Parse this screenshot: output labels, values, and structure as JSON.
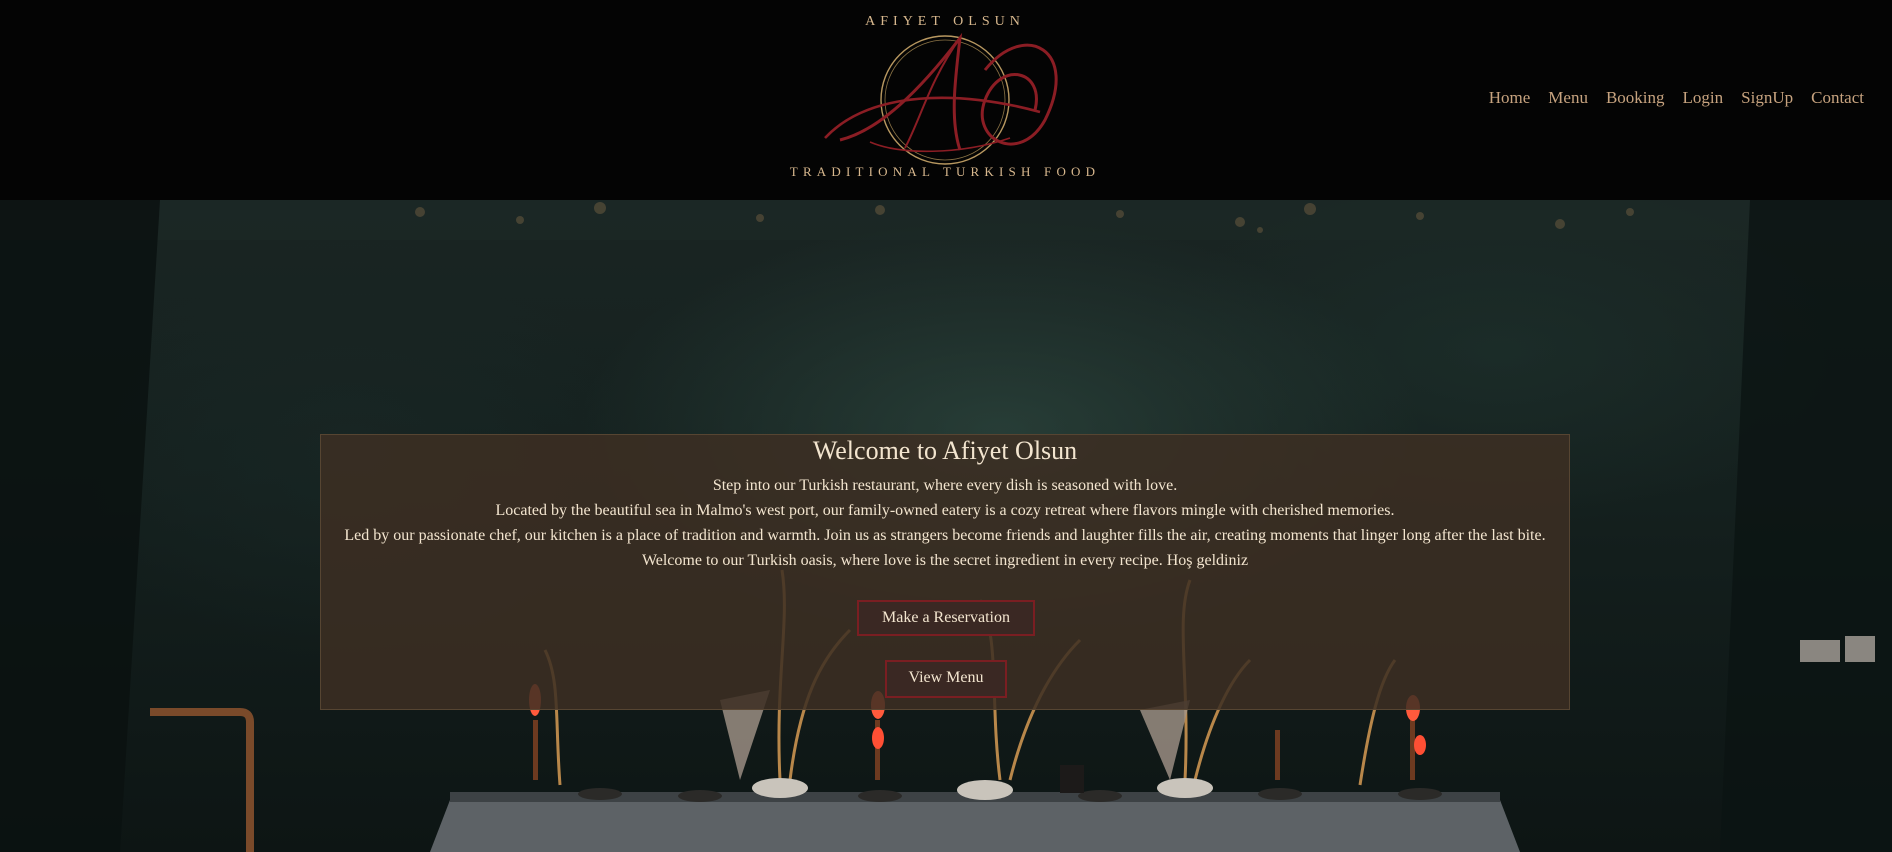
{
  "brand": {
    "name_top": "AFIYET OLSUN",
    "tagline": "TRADITIONAL TURKISH FOOD",
    "monogram": "AO",
    "colors": {
      "gold": "#d8b88e",
      "crimson": "#8b1d24"
    }
  },
  "nav": {
    "items": [
      {
        "label": "Home"
      },
      {
        "label": "Menu"
      },
      {
        "label": "Booking"
      },
      {
        "label": "Login"
      },
      {
        "label": "SignUp"
      },
      {
        "label": "Contact"
      }
    ]
  },
  "welcome": {
    "title": "Welcome to Afiyet Olsun",
    "lines": [
      "Step into our Turkish restaurant, where every dish is seasoned with love.",
      "Located by the beautiful sea in Malmo's west port, our family-owned eatery is a cozy retreat where flavors mingle with cherished memories.",
      "Led by our passionate chef, our kitchen is a place of tradition and warmth. Join us as strangers become friends and laughter fills the air, creating moments that linger long after the last bite.",
      "Welcome to our Turkish oasis, where love is the secret ingredient in every recipe. Hoş geldiniz"
    ],
    "reserve_label": "Make a Reservation",
    "menu_label": "View Menu"
  },
  "hero": {
    "image_subject": "candle-lit-dining-table",
    "colors": {
      "wall": "#1a2523",
      "candle": "#ff5a3c",
      "tablecloth": "#6f7275"
    }
  }
}
